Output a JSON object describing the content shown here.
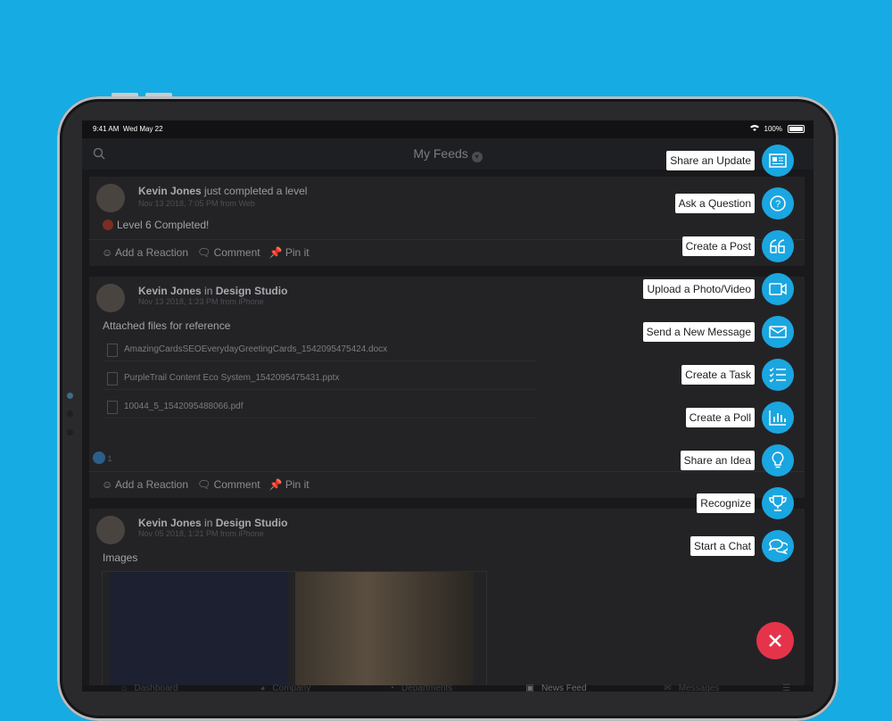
{
  "status_bar": {
    "time": "9:41 AM",
    "date": "Wed May 22",
    "battery": "100%"
  },
  "nav": {
    "title": "My Feeds"
  },
  "posts": [
    {
      "author": "Kevin Jones",
      "action": "just completed a level",
      "group": "",
      "meta": "Nov 13 2018, 7:05 PM from Web",
      "body": "Level 6 Completed!"
    },
    {
      "author": "Kevin Jones",
      "action": "in",
      "group": "Design Studio",
      "meta": "Nov 13 2018, 1:23 PM from iPhone",
      "body": "Attached files for reference",
      "files": [
        "AmazingCardsSEOEverydayGreetingCards_1542095475424.docx",
        "PurpleTrail Content Eco System_1542095475431.pptx",
        "10044_5_1542095488066.pdf"
      ],
      "reaction_count": "1"
    },
    {
      "author": "Kevin Jones",
      "action": "in",
      "group": "Design Studio",
      "meta": "Nov 05 2018, 1:21 PM from iPhone",
      "body": "Images"
    }
  ],
  "actions": {
    "reaction": "Add a Reaction",
    "comment": "Comment",
    "pin": "Pin it"
  },
  "tabs": [
    "Dashboard",
    "Company",
    "Departments",
    "News Feed",
    "Messages"
  ],
  "fab_menu": [
    {
      "label": "Share an Update",
      "icon": "newspaper-icon"
    },
    {
      "label": "Ask a Question",
      "icon": "question-circle-icon"
    },
    {
      "label": "Create a Post",
      "icon": "quote-icon"
    },
    {
      "label": "Upload a Photo/Video",
      "icon": "video-camera-icon"
    },
    {
      "label": "Send a New Message",
      "icon": "envelope-icon"
    },
    {
      "label": "Create a Task",
      "icon": "checklist-icon"
    },
    {
      "label": "Create a Poll",
      "icon": "bar-chart-icon"
    },
    {
      "label": "Share an Idea",
      "icon": "lightbulb-icon"
    },
    {
      "label": "Recognize",
      "icon": "trophy-icon"
    },
    {
      "label": "Start a Chat",
      "icon": "chat-bubbles-icon"
    }
  ],
  "colors": {
    "background": "#16ace3",
    "fab": "#1aa6e0",
    "close": "#e5344a"
  }
}
